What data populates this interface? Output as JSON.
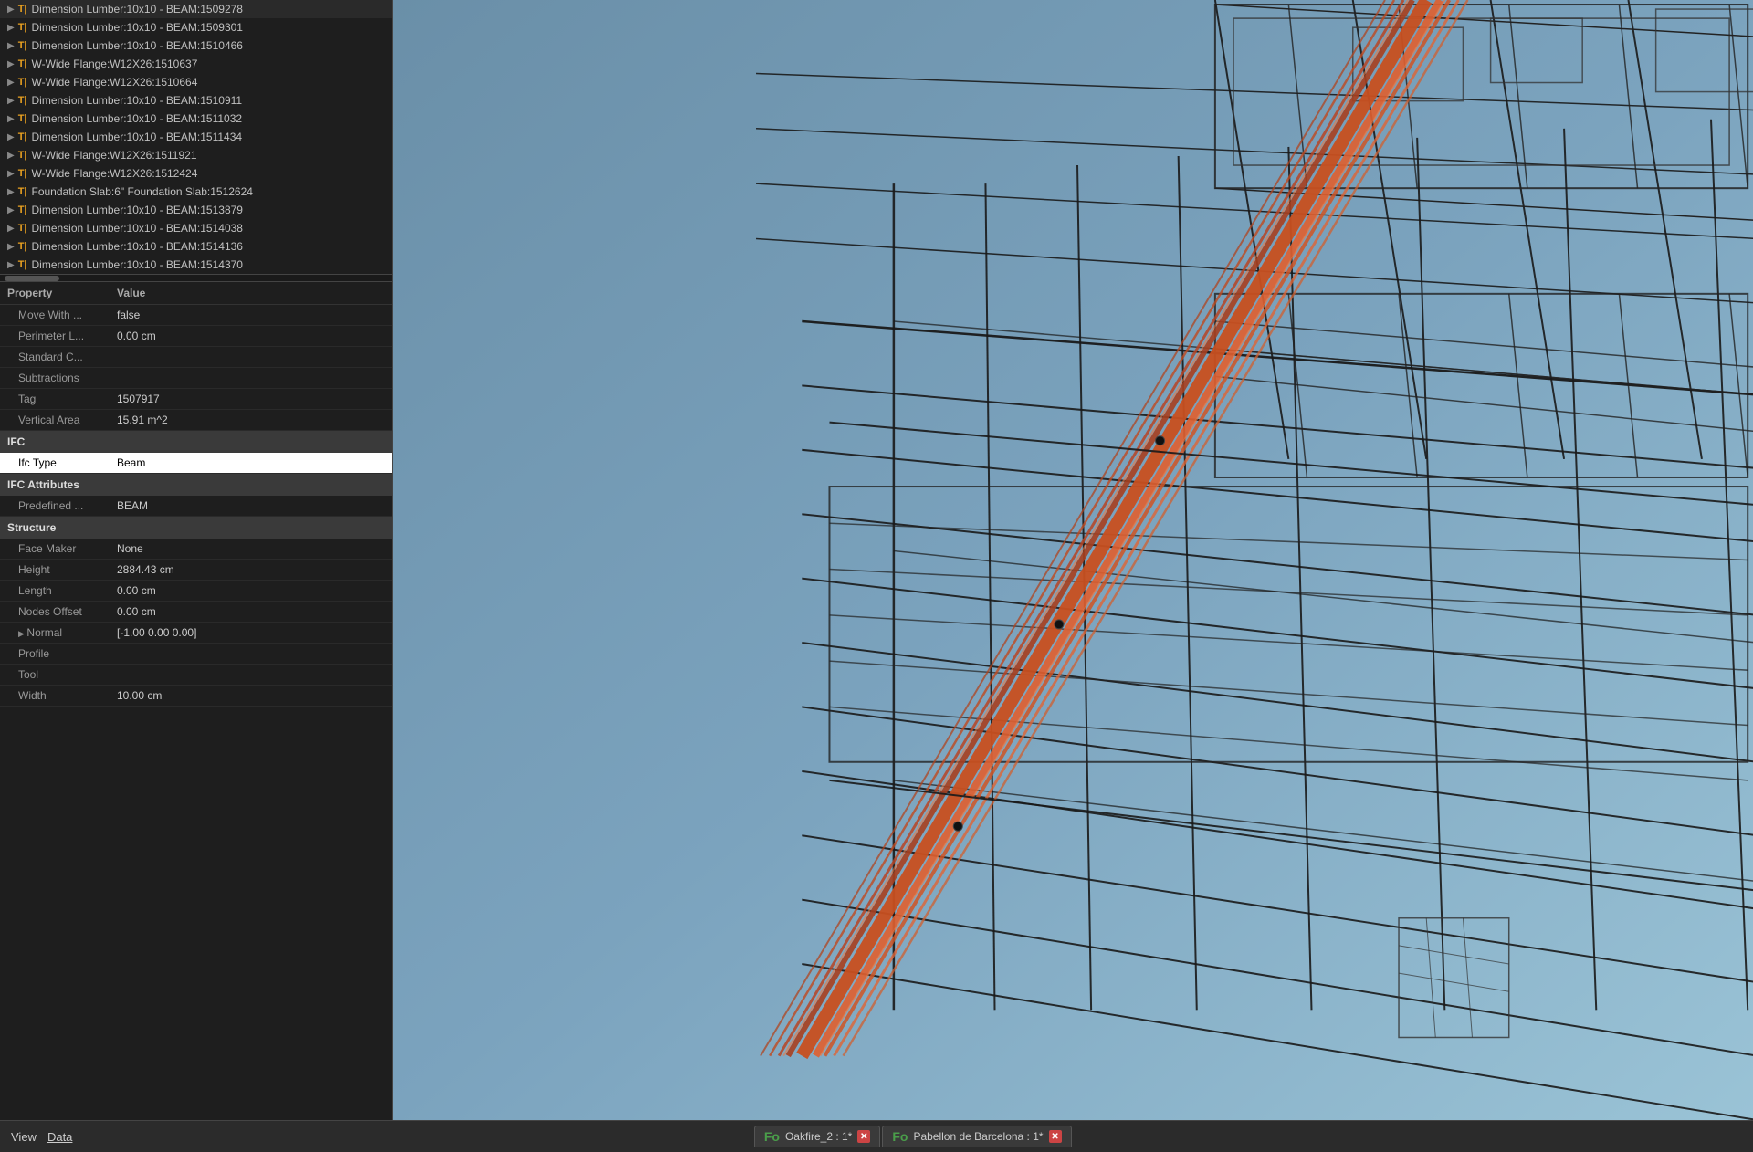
{
  "leftPanel": {
    "treeItems": [
      {
        "arrow": true,
        "icon": "T",
        "text": "Dimension Lumber:10x10 - BEAM:1509278"
      },
      {
        "arrow": true,
        "icon": "T",
        "text": "Dimension Lumber:10x10 - BEAM:1509301"
      },
      {
        "arrow": true,
        "icon": "T",
        "text": "Dimension Lumber:10x10 - BEAM:1510466"
      },
      {
        "arrow": true,
        "icon": "T",
        "text": "W-Wide Flange:W12X26:1510637"
      },
      {
        "arrow": true,
        "icon": "T",
        "text": "W-Wide Flange:W12X26:1510664"
      },
      {
        "arrow": true,
        "icon": "T",
        "text": "Dimension Lumber:10x10 - BEAM:1510911"
      },
      {
        "arrow": true,
        "icon": "T",
        "text": "Dimension Lumber:10x10 - BEAM:1511032"
      },
      {
        "arrow": true,
        "icon": "T",
        "text": "Dimension Lumber:10x10 - BEAM:1511434"
      },
      {
        "arrow": true,
        "icon": "T",
        "text": "W-Wide Flange:W12X26:1511921"
      },
      {
        "arrow": true,
        "icon": "T",
        "text": "W-Wide Flange:W12X26:1512424"
      },
      {
        "arrow": true,
        "icon": "T",
        "text": "Foundation Slab:6\" Foundation Slab:1512624"
      },
      {
        "arrow": true,
        "icon": "T",
        "text": "Dimension Lumber:10x10 - BEAM:1513879"
      },
      {
        "arrow": true,
        "icon": "T",
        "text": "Dimension Lumber:10x10 - BEAM:1514038"
      },
      {
        "arrow": true,
        "icon": "T",
        "text": "Dimension Lumber:10x10 - BEAM:1514136"
      },
      {
        "arrow": true,
        "icon": "T",
        "text": "Dimension Lumber:10x10 - BEAM:1514370"
      }
    ],
    "propertiesHeader": {
      "property": "Property",
      "value": "Value"
    },
    "propertyGroups": [
      {
        "type": "rows",
        "rows": [
          {
            "property": "Move With ...",
            "value": "false",
            "indent": true
          },
          {
            "property": "Perimeter L...",
            "value": "0.00 cm",
            "indent": true
          },
          {
            "property": "Standard C...",
            "value": "",
            "indent": true
          },
          {
            "property": "Subtractions",
            "value": "",
            "indent": true
          },
          {
            "property": "Tag",
            "value": "1507917",
            "indent": true
          },
          {
            "property": "Vertical Area",
            "value": "15.91 m^2",
            "indent": true
          }
        ]
      },
      {
        "type": "section",
        "title": "IFC",
        "rows": [
          {
            "property": "Ifc Type",
            "value": "Beam",
            "selected": true,
            "indent": true
          }
        ]
      },
      {
        "type": "section",
        "title": "IFC Attributes",
        "rows": [
          {
            "property": "Predefined ...",
            "value": "BEAM",
            "indent": true
          }
        ]
      },
      {
        "type": "section",
        "title": "Structure",
        "rows": [
          {
            "property": "Face Maker",
            "value": "None",
            "indent": true
          },
          {
            "property": "Height",
            "value": "2884.43 cm",
            "indent": true
          },
          {
            "property": "Length",
            "value": "0.00 cm",
            "indent": true
          },
          {
            "property": "Nodes Offset",
            "value": "0.00 cm",
            "indent": true
          },
          {
            "property": "Normal",
            "value": "[-1.00 0.00 0.00]",
            "indent": true,
            "arrow": true
          },
          {
            "property": "Profile",
            "value": "",
            "indent": true
          },
          {
            "property": "Tool",
            "value": "",
            "indent": true
          },
          {
            "property": "Width",
            "value": "10.00 cm",
            "indent": true
          }
        ]
      }
    ]
  },
  "bottomBar": {
    "menuItems": [
      {
        "label": "View",
        "underline": false
      },
      {
        "label": "Data",
        "underline": true
      }
    ],
    "tabs": [
      {
        "icon": "Fo",
        "label": "Oakfire_2 : 1*",
        "hasClose": true
      },
      {
        "icon": "Fo",
        "label": "Pabellon de Barcelona : 1*",
        "hasClose": true
      }
    ]
  },
  "colors": {
    "accent": "#cc4444",
    "tabIcon": "#4a9e4a",
    "sectionHeader": "#3a3a3a",
    "selectedRow": "#ffffff",
    "highlightBeam": "#cc5533"
  }
}
